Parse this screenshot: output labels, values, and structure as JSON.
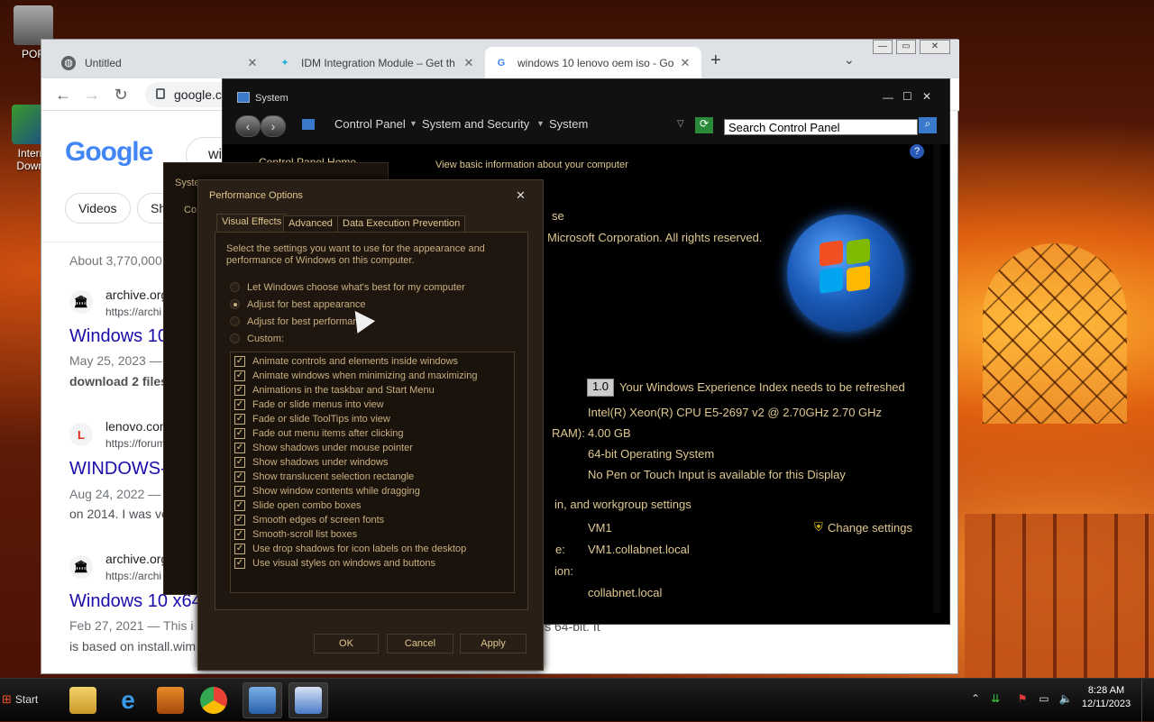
{
  "desktop": {
    "icons": [
      {
        "label": "POR"
      },
      {
        "label": "Intern Downl"
      }
    ]
  },
  "chrome": {
    "tabs": [
      {
        "label": "Untitled",
        "close": "✕"
      },
      {
        "label": "IDM Integration Module – Get th",
        "close": "✕"
      },
      {
        "label": "windows 10 lenovo oem iso - Go",
        "close": "✕"
      }
    ],
    "new_tab": "+",
    "tab_menu": "⌄",
    "window_controls": {
      "minimize": "—",
      "restore": "▭",
      "close": "✕"
    },
    "nav": {
      "back": "←",
      "forward": "→",
      "reload": "↻"
    },
    "address": "google.co",
    "page": {
      "logo": "Google",
      "search_fragment": "wi",
      "chips": [
        "Videos",
        "Sh"
      ],
      "result_count": "About 3,770,000",
      "results": [
        {
          "site": "archive.org",
          "url": "https://archi",
          "title": "Windows 10",
          "meta": "May 25, 2023 —",
          "snippet": "download 2 files"
        },
        {
          "site": "lenovo.com",
          "url": "https://forum",
          "title": "WINDOWS-",
          "meta": "Aug 24, 2022 —",
          "snippet": "on 2014. I was ve"
        },
        {
          "site": "archive.org",
          "url": "https://archi",
          "title": "Windows 10 x64",
          "meta": "Feb 27, 2021 — This i",
          "snippet": "is based on install.wim"
        }
      ],
      "snippet_tail": "is 64-bit. It"
    }
  },
  "system_window": {
    "title": "System",
    "controls": {
      "minimize": "—",
      "maximize": "☐",
      "close": "✕"
    },
    "breadcrumb": [
      "Control Panel",
      "System and Security",
      "System"
    ],
    "search_placeholder": "Search Control Panel",
    "help": "?",
    "sidebar_home": "Control Panel Home",
    "header_fragment": "View basic information about your computer",
    "edition_fragment": "se",
    "copyright_fragment": "Microsoft Corporation.  All rights reserved.",
    "wei_score": "1.0",
    "wei_text": "Your Windows Experience Index needs to be refreshed",
    "processor": "Intel(R) Xeon(R) CPU E5-2697 v2 @ 2.70GHz   2.70 GHz",
    "ram_label_fragment": "RAM):",
    "ram": "4.00 GB",
    "system_type": "64-bit Operating System",
    "pen_touch": "No Pen or Touch Input is available for this Display",
    "section_fragment": "in, and workgroup settings",
    "computer_name": "VM1",
    "change_settings": "Change settings",
    "full_name_fragment": "e:",
    "full_name": "VM1.collabnet.local",
    "desc_fragment": "ion:",
    "domain": "collabnet.local"
  },
  "sysprops": {
    "title_fragment": "Syste",
    "tab_fragment": "Co"
  },
  "perf": {
    "title": "Performance Options",
    "close": "✕",
    "tabs": [
      "Visual Effects",
      "Advanced",
      "Data Execution Prevention"
    ],
    "intro": "Select the settings you want to use for the appearance and performance of Windows on this computer.",
    "radios": [
      {
        "label": "Let Windows choose what's best for my computer",
        "on": false
      },
      {
        "label": "Adjust for best appearance",
        "on": true
      },
      {
        "label": "Adjust for best performance",
        "on": false
      },
      {
        "label": "Custom:",
        "on": false
      }
    ],
    "effects": [
      "Animate controls and elements inside windows",
      "Animate windows when minimizing and maximizing",
      "Animations in the taskbar and Start Menu",
      "Fade or slide menus into view",
      "Fade or slide ToolTips into view",
      "Fade out menu items after clicking",
      "Show shadows under mouse pointer",
      "Show shadows under windows",
      "Show translucent selection rectangle",
      "Show window contents while dragging",
      "Slide open combo boxes",
      "Smooth edges of screen fonts",
      "Smooth-scroll list boxes",
      "Use drop shadows for icon labels on the desktop",
      "Use visual styles on windows and buttons"
    ],
    "buttons": {
      "ok": "OK",
      "cancel": "Cancel",
      "apply": "Apply"
    }
  },
  "taskbar": {
    "start": "Start",
    "clock_time": "8:28 AM",
    "clock_date": "12/11/2023",
    "tray": [
      "⌃"
    ]
  },
  "colors": {
    "accent_text": "#e0c890",
    "link": "#1a0dab",
    "chrome_bg": "#dee1e6"
  }
}
